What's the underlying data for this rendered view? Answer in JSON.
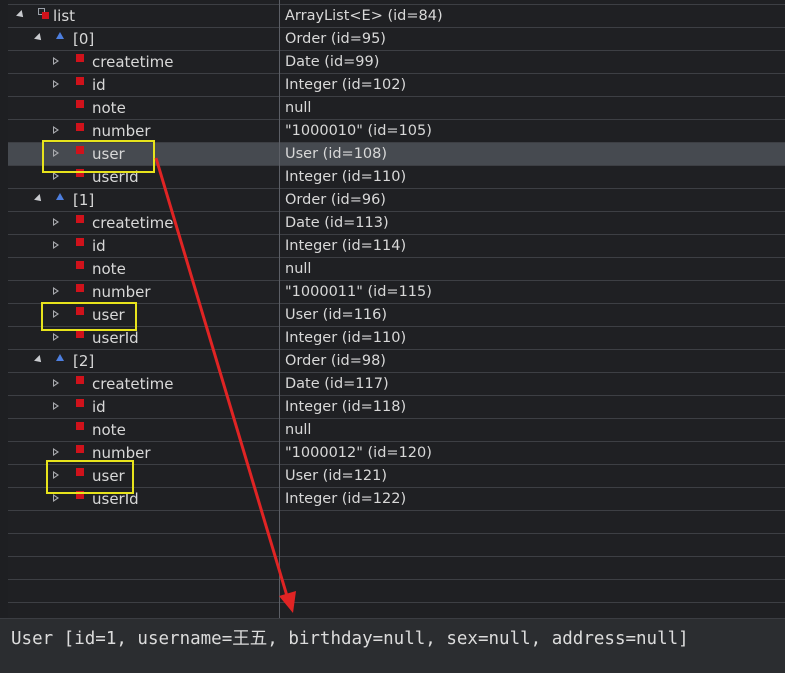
{
  "variables": {
    "rows": [
      {
        "name": "list",
        "value": "ArrayList<E>  (id=84)"
      },
      {
        "name": "[0]",
        "value": "Order  (id=95)"
      },
      {
        "name": "createtime",
        "value": "Date  (id=99)"
      },
      {
        "name": "id",
        "value": "Integer  (id=102)"
      },
      {
        "name": "note",
        "value": "null"
      },
      {
        "name": "number",
        "value": "\"1000010\" (id=105)"
      },
      {
        "name": "user",
        "value": "User  (id=108)"
      },
      {
        "name": "userId",
        "value": "Integer  (id=110)"
      },
      {
        "name": "[1]",
        "value": "Order  (id=96)"
      },
      {
        "name": "createtime",
        "value": "Date  (id=113)"
      },
      {
        "name": "id",
        "value": "Integer  (id=114)"
      },
      {
        "name": "note",
        "value": "null"
      },
      {
        "name": "number",
        "value": "\"1000011\" (id=115)"
      },
      {
        "name": "user",
        "value": "User  (id=116)"
      },
      {
        "name": "userId",
        "value": "Integer  (id=110)"
      },
      {
        "name": "[2]",
        "value": "Order  (id=98)"
      },
      {
        "name": "createtime",
        "value": "Date  (id=117)"
      },
      {
        "name": "id",
        "value": "Integer  (id=118)"
      },
      {
        "name": "note",
        "value": "null"
      },
      {
        "name": "number",
        "value": "\"1000012\" (id=120)"
      },
      {
        "name": "user",
        "value": "User  (id=121)"
      },
      {
        "name": "userId",
        "value": "Integer  (id=122)"
      }
    ]
  },
  "detail": {
    "text": "User [id=1, username=王五, birthday=null, sex=null, address=null]"
  },
  "colors": {
    "highlight": "#e7e31c",
    "arrow": "#e02424",
    "field_icon": "#d0121b",
    "array_icon": "#4d7fe0"
  }
}
